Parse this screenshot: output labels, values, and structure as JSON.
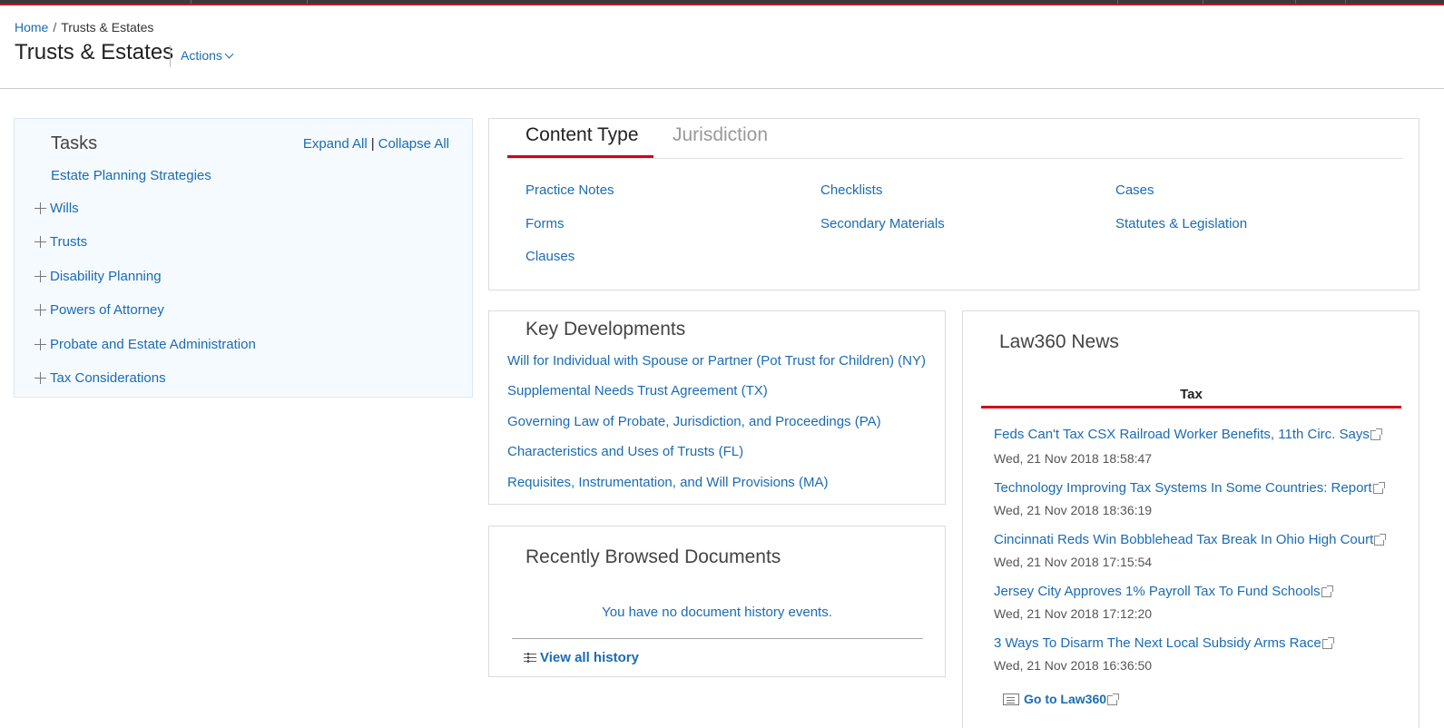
{
  "breadcrumb": {
    "home": "Home",
    "separator": "/",
    "current": "Trusts & Estates"
  },
  "page": {
    "title": "Trusts & Estates",
    "actions_label": "Actions"
  },
  "tasks": {
    "title": "Tasks",
    "expand_all": "Expand All",
    "separator": "|",
    "collapse_all": "Collapse All",
    "strategies": "Estate Planning Strategies",
    "items": [
      {
        "label": "Wills"
      },
      {
        "label": "Trusts"
      },
      {
        "label": "Disability Planning"
      },
      {
        "label": "Powers of Attorney"
      },
      {
        "label": "Probate and Estate Administration"
      },
      {
        "label": "Tax Considerations"
      }
    ]
  },
  "content": {
    "tabs": [
      {
        "label": "Content Type"
      },
      {
        "label": "Jurisdiction"
      }
    ],
    "types": [
      {
        "label": "Practice Notes"
      },
      {
        "label": "Checklists"
      },
      {
        "label": "Cases"
      },
      {
        "label": "Forms"
      },
      {
        "label": "Secondary Materials"
      },
      {
        "label": "Statutes & Legislation"
      },
      {
        "label": "Clauses"
      }
    ]
  },
  "key_developments": {
    "title": "Key Developments",
    "items": [
      {
        "label": "Will for Individual with Spouse or Partner (Pot Trust for Children) (NY)"
      },
      {
        "label": "Supplemental Needs Trust Agreement (TX)"
      },
      {
        "label": "Governing Law of Probate, Jurisdiction, and Proceedings (PA)"
      },
      {
        "label": "Characteristics and Uses of Trusts (FL)"
      },
      {
        "label": "Requisites, Instrumentation, and Will Provisions (MA)"
      }
    ]
  },
  "recent": {
    "title": "Recently Browsed Documents",
    "empty_message": "You have no document history events.",
    "view_all": "View all history",
    "icon": "list-icon"
  },
  "law360": {
    "title": "Law360 News",
    "tab": "Tax",
    "news": [
      {
        "title": "Feds Can't Tax CSX Railroad Worker Benefits, 11th Circ. Says",
        "date": "Wed, 21 Nov 2018 18:58:47"
      },
      {
        "title": "Technology Improving Tax Systems In Some Countries: Report",
        "date": "Wed, 21 Nov 2018 18:36:19"
      },
      {
        "title": "Cincinnati Reds Win Bobblehead Tax Break In Ohio High Court",
        "date": "Wed, 21 Nov 2018 17:15:54"
      },
      {
        "title": "Jersey City Approves 1% Payroll Tax To Fund Schools",
        "date": "Wed, 21 Nov 2018 17:12:20"
      },
      {
        "title": "3 Ways To Disarm The Next Local Subsidy Arms Race",
        "date": "Wed, 21 Nov 2018 16:36:50"
      }
    ],
    "go_link": "Go to Law360"
  },
  "colors": {
    "link": "#1a6bb5",
    "accent": "#d0021b",
    "tasks_bg": "#f5fafe"
  }
}
